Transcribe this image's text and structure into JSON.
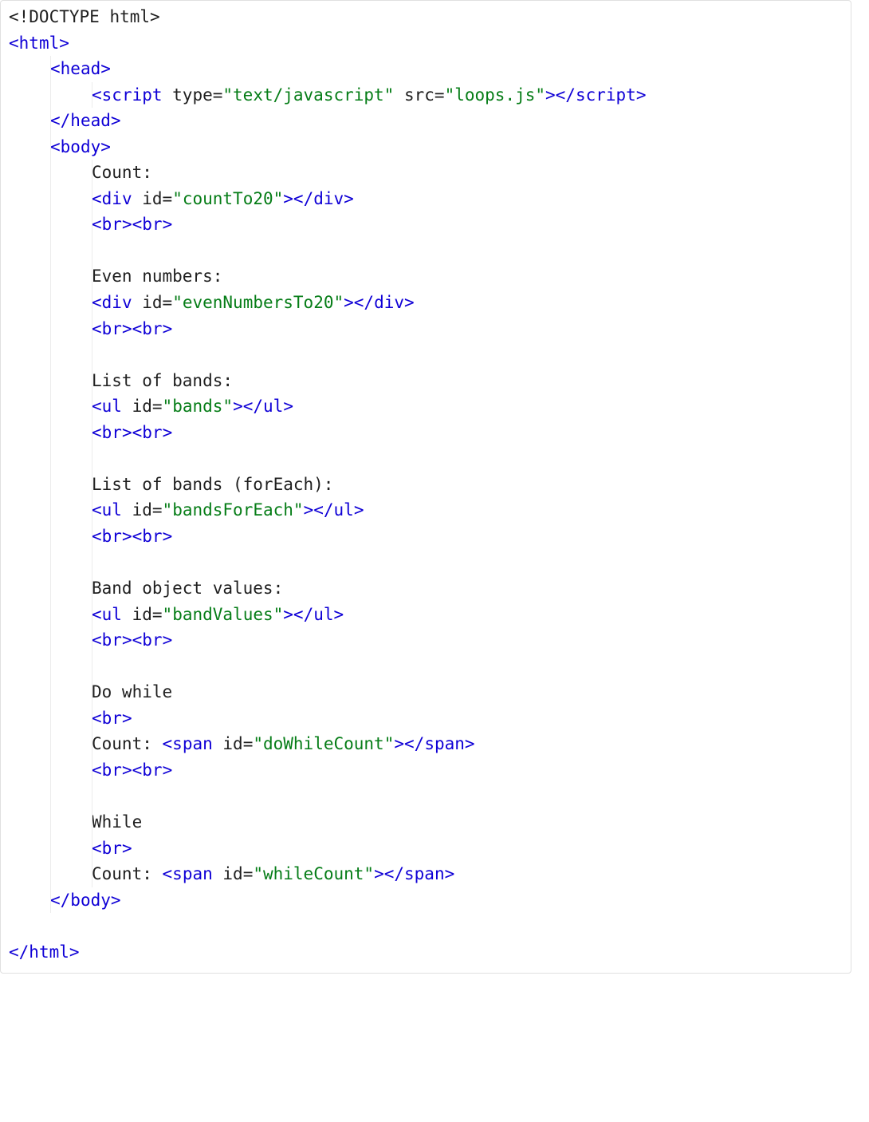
{
  "tokens": {
    "lt": "<",
    "gt": ">",
    "lts": "</",
    "bangDoctype": "<!DOCTYPE",
    "spaceHtmlGt": " html>",
    "html": "html",
    "head": "head",
    "body": "body",
    "script": "script",
    "div": "div",
    "ul": "ul",
    "span": "span",
    "br": "br",
    "typeAttr": " type",
    "srcAttr": " src",
    "idAttr": " id",
    "eq": "=",
    "valTextJs": "\"text/javascript\"",
    "valLoopsJs": "\"loops.js\"",
    "valCountTo20": "\"countTo20\"",
    "valEvenNumbersTo20": "\"evenNumbersTo20\"",
    "valBands": "\"bands\"",
    "valBandsForEach": "\"bandsForEach\"",
    "valBandValues": "\"bandValues\"",
    "valDoWhileCount": "\"doWhileCount\"",
    "valWhileCount": "\"whileCount\""
  },
  "texts": {
    "count": "Count:",
    "evenNumbers": "Even numbers:",
    "listOfBands": "List of bands:",
    "listOfBandsForEach": "List of bands (forEach):",
    "bandObjectValues": "Band object values:",
    "doWhile": "Do while",
    "countInline": "Count: ",
    "while": "While"
  }
}
